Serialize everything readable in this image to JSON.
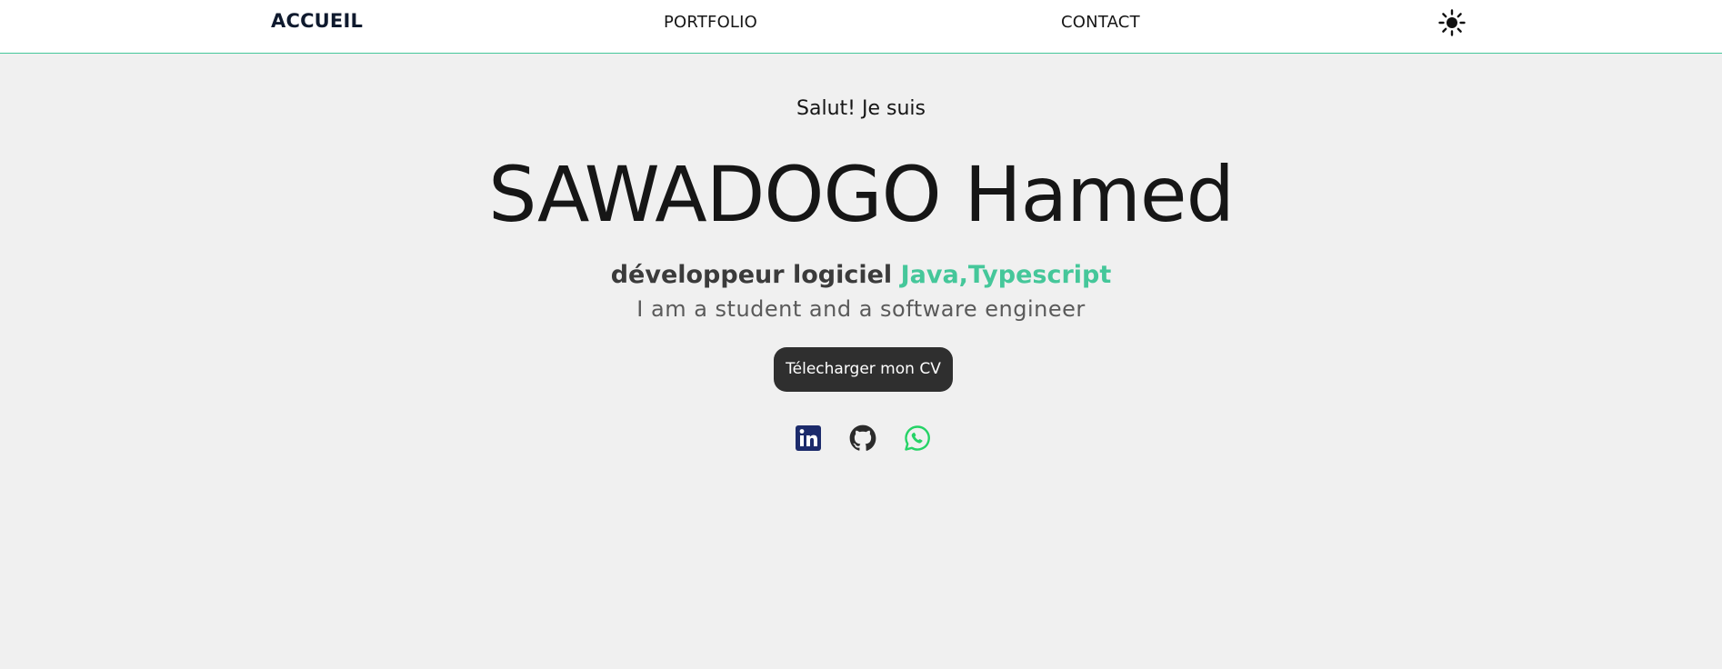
{
  "nav": {
    "home": "ACCUEIL",
    "portfolio": "PORTFOLIO",
    "contact": "CONTACT",
    "theme_icon": "sun-icon"
  },
  "hero": {
    "greeting": "Salut! Je suis",
    "name": "SAWADOGO Hamed",
    "role": "développeur logiciel",
    "tech": "Java,Typescript",
    "tagline": "I am a student and a software engineer",
    "cv_button": "Télecharger mon CV"
  },
  "social": {
    "icons": [
      "linkedin-icon",
      "github-icon",
      "whatsapp-icon"
    ]
  },
  "colors": {
    "accent": "#45c79a",
    "background": "#f0f0f0",
    "navbar": "#ffffff",
    "button": "#2f2f2f",
    "linkedin": "#1c2b6b",
    "whatsapp": "#25d366"
  }
}
